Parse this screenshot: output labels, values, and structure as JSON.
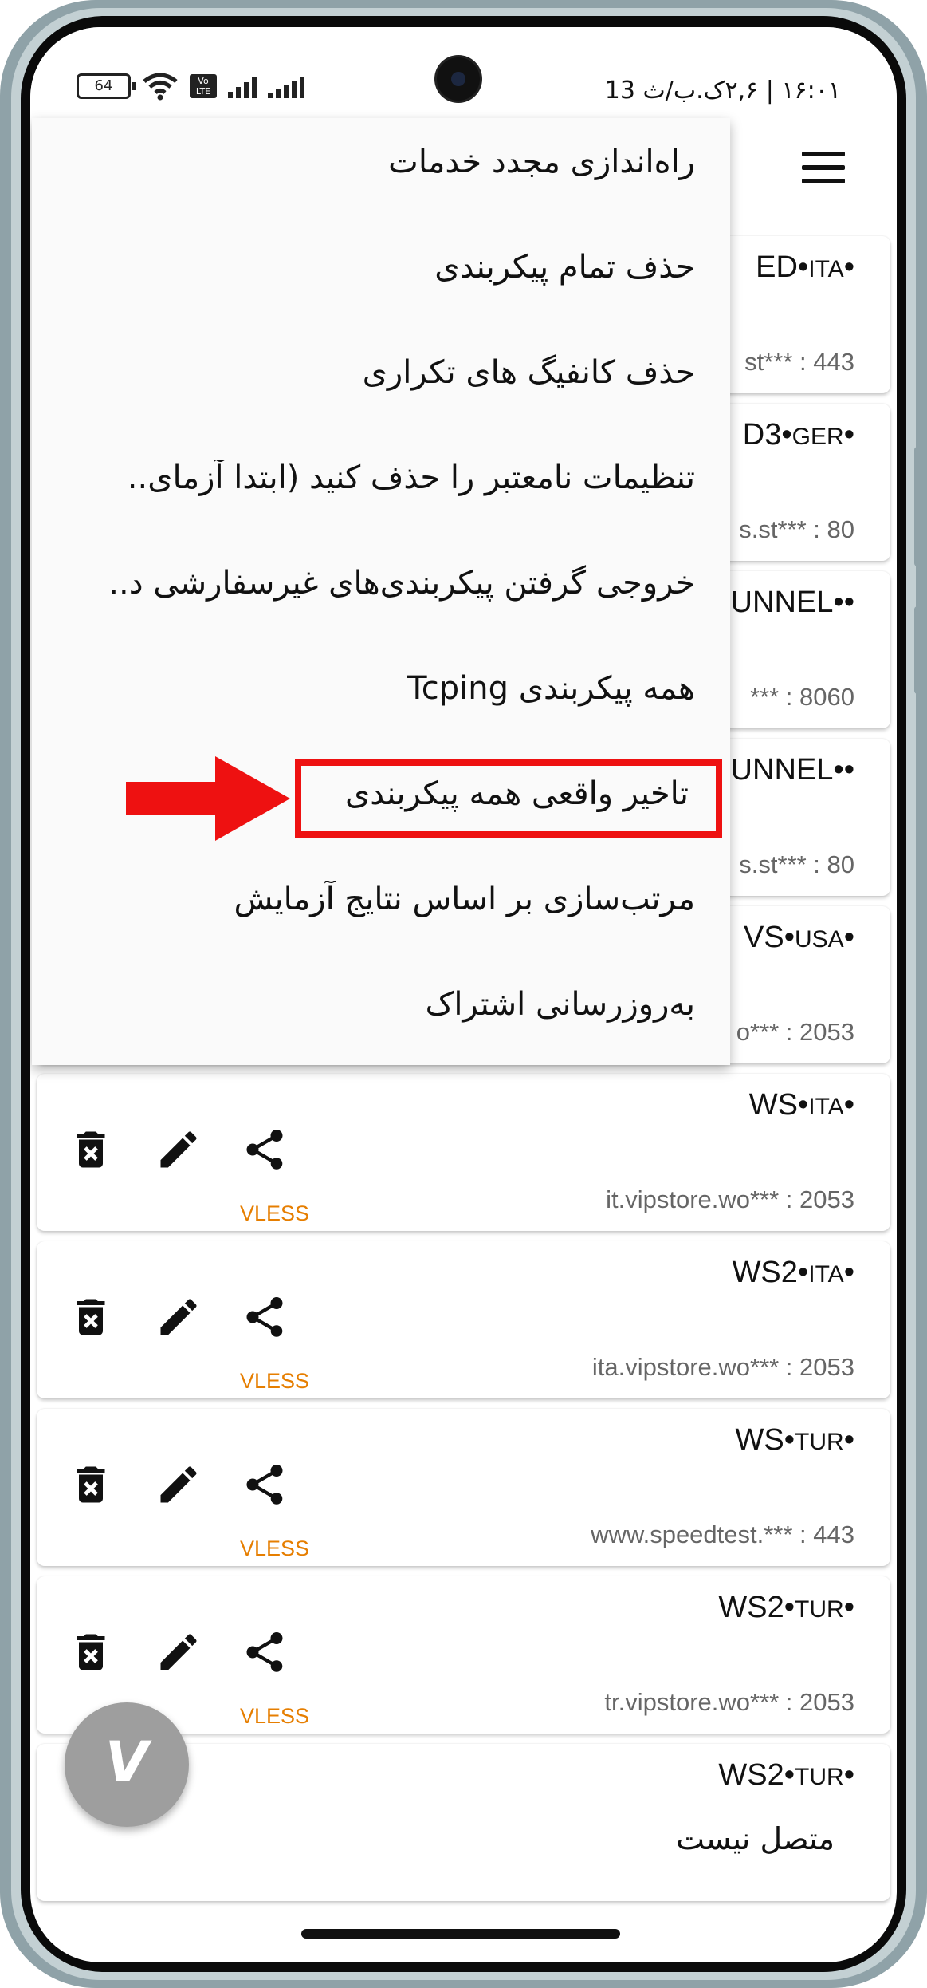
{
  "status_bar": {
    "time": "۱۶:۰۱ | ۲,۶ک.ب/ث 13",
    "battery": "64",
    "volte": "Vo LTE"
  },
  "popup_menu": {
    "items": [
      "راه‌اندازی مجدد خدمات",
      "حذف تمام پیکربندی",
      "حذف کانفیگ های تکراری",
      "تنظیمات نامعتبر را حذف کنید (ابتدا آزمای..",
      "خروجی گرفتن پیکربندی‌های غیرسفارشی د..",
      "همه پیکربندی Tcping",
      "تاخیر واقعی همه پیکربندی",
      "مرتب‌سازی بر اساس نتایج آزمایش",
      "به‌روزرسانی اشتراک"
    ],
    "highlighted_index": 6,
    "highlight_color": "#ee1111"
  },
  "servers": [
    {
      "title": "ED",
      "cc": "ITA",
      "addr": "st*** : 443"
    },
    {
      "title": "D3",
      "cc": "GER",
      "addr": "s.st*** : 80"
    },
    {
      "title": "TUNNEL",
      "cc": "",
      "addr": "*** : 8060"
    },
    {
      "title": "TUNNEL",
      "cc": "",
      "addr": "s.st*** : 80"
    },
    {
      "title": "VS",
      "cc": "USA",
      "addr": "o*** : 2053"
    },
    {
      "title": "WS",
      "cc": "ITA",
      "addr": "it.vipstore.wo*** : 2053",
      "type": "VLESS"
    },
    {
      "title": "WS2",
      "cc": "ITA",
      "addr": "ita.vipstore.wo*** : 2053",
      "type": "VLESS"
    },
    {
      "title": "WS",
      "cc": "TUR",
      "addr": "www.speedtest.*** : 443",
      "type": "VLESS"
    },
    {
      "title": "WS2",
      "cc": "TUR",
      "addr": "tr.vipstore.wo*** : 2053",
      "type": "VLESS"
    },
    {
      "title": "WS2",
      "cc": "TUR",
      "addr": ""
    }
  ],
  "fab": {
    "label": "V",
    "color": "#9e9e9e"
  },
  "connection_status": "متصل نیست",
  "colors": {
    "protocol": "#e67e00",
    "accent_red": "#ee1111"
  }
}
